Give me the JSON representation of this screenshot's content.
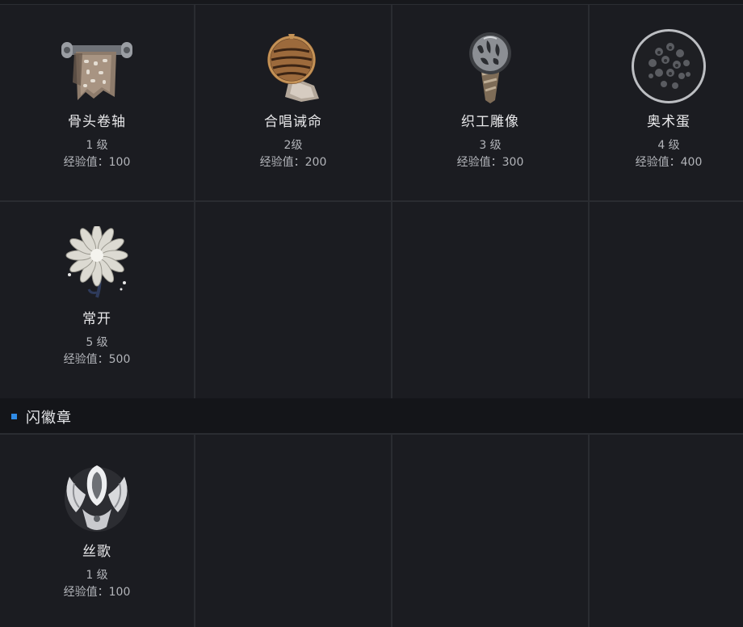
{
  "items": [
    {
      "name": "骨头卷轴",
      "level": "1 级",
      "exp": "经验值：100",
      "icon": "bone-scroll-icon"
    },
    {
      "name": "合唱诫命",
      "level": "2级",
      "exp": "经验值：200",
      "icon": "choral-commandment-icon"
    },
    {
      "name": "织工雕像",
      "level": "3 级",
      "exp": "经验值：300",
      "icon": "weaver-effigy-icon"
    },
    {
      "name": "奥术蛋",
      "level": "4 级",
      "exp": "经验值：400",
      "icon": "arcane-egg-icon"
    },
    {
      "name": "常开",
      "level": "5 级",
      "exp": "经验值：500",
      "icon": "everbloom-icon"
    }
  ],
  "badges_section": {
    "title": "闪徽章",
    "items": [
      {
        "name": "丝歌",
        "level": "1 级",
        "exp": "经验值：100",
        "icon": "silksong-crest-icon"
      }
    ]
  }
}
